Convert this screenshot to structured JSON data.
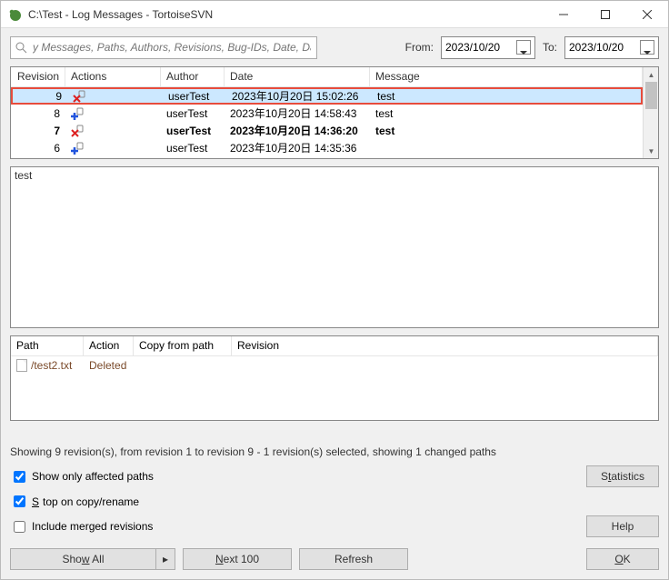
{
  "window": {
    "title": "C:\\Test - Log Messages - TortoiseSVN"
  },
  "search": {
    "placeholder": "y Messages, Paths, Authors, Revisions, Bug-IDs, Date, Dat"
  },
  "dates": {
    "from_label": "From:",
    "to_label": "To:",
    "from": "2023/10/20",
    "to": "2023/10/20"
  },
  "grid1_headers": {
    "revision": "Revision",
    "actions": "Actions",
    "author": "Author",
    "date": "Date",
    "message": "Message"
  },
  "revisions": [
    {
      "rev": "9",
      "author": "userTest",
      "date": "2023年10月20日 15:02:26",
      "msg": "test",
      "selected": true,
      "bold": false,
      "action_icon": "delete"
    },
    {
      "rev": "8",
      "author": "userTest",
      "date": "2023年10月20日 14:58:43",
      "msg": "test",
      "selected": false,
      "bold": false,
      "action_icon": "add"
    },
    {
      "rev": "7",
      "author": "userTest",
      "date": "2023年10月20日 14:36:20",
      "msg": "test",
      "selected": false,
      "bold": true,
      "action_icon": "delete"
    },
    {
      "rev": "6",
      "author": "userTest",
      "date": "2023年10月20日 14:35:36",
      "msg": "",
      "selected": false,
      "bold": false,
      "action_icon": "add"
    }
  ],
  "message_text": "test",
  "grid2_headers": {
    "path": "Path",
    "action": "Action",
    "copy": "Copy from path",
    "revision": "Revision"
  },
  "changed_paths": [
    {
      "path": "/test2.txt",
      "action": "Deleted",
      "copy": "",
      "rev": ""
    }
  ],
  "status": "Showing 9 revision(s), from revision 1 to revision 9 - 1 revision(s) selected, showing 1 changed paths",
  "checks": {
    "affected": {
      "label": "Show only affected paths",
      "checked": true
    },
    "stop": {
      "label": "Stop on copy/rename",
      "checked": true
    },
    "merged": {
      "label": "Include merged revisions",
      "checked": false
    }
  },
  "buttons": {
    "statistics": "Statistics",
    "help": "Help",
    "show_all": "Show All",
    "next100": "Next 100",
    "refresh": "Refresh",
    "ok": "OK"
  }
}
